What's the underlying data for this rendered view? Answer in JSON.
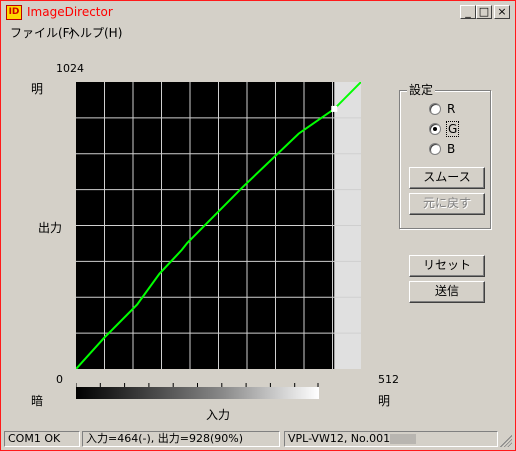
{
  "window": {
    "title": "ImageDirector",
    "icon_text": "ID",
    "controls": {
      "minimize": "_",
      "maximize": "□",
      "close": "×"
    },
    "border_color": "#ff1a1a",
    "title_color": "#ff0000"
  },
  "menu": [
    {
      "label": "ファイル(F)"
    },
    {
      "label": "ヘルプ(H)"
    }
  ],
  "axis": {
    "y_max_label": "1024",
    "y_bright_label": "明",
    "y_title": "出力",
    "y_min_label": "0",
    "x_dark_label": "暗",
    "x_max_label": "512",
    "x_bright_label": "明",
    "x_title": "入力"
  },
  "settings": {
    "group_title": "設定",
    "options": [
      "R",
      "G",
      "B"
    ],
    "selected": "G",
    "smooth_button": "スムース",
    "undo_button": "元に戻す"
  },
  "buttons": {
    "reset": "リセット",
    "send": "送信"
  },
  "status": {
    "port": "COM1 OK",
    "io": "入力=464(-), 出力=928(90%)",
    "device": "VPL-VW12, No.001"
  },
  "chart_data": {
    "type": "line",
    "xlim": [
      0,
      512
    ],
    "ylim": [
      0,
      1024
    ],
    "grid": true,
    "line_color": "#00ff00",
    "background": "#000000",
    "unused_region_start_x": 464,
    "x": [
      0,
      50,
      100,
      110,
      150,
      190,
      200,
      250,
      300,
      400,
      464,
      512
    ],
    "y": [
      0,
      110,
      210,
      230,
      340,
      425,
      450,
      550,
      650,
      840,
      928,
      1024
    ],
    "marker": {
      "x": 464,
      "y": 928
    }
  }
}
